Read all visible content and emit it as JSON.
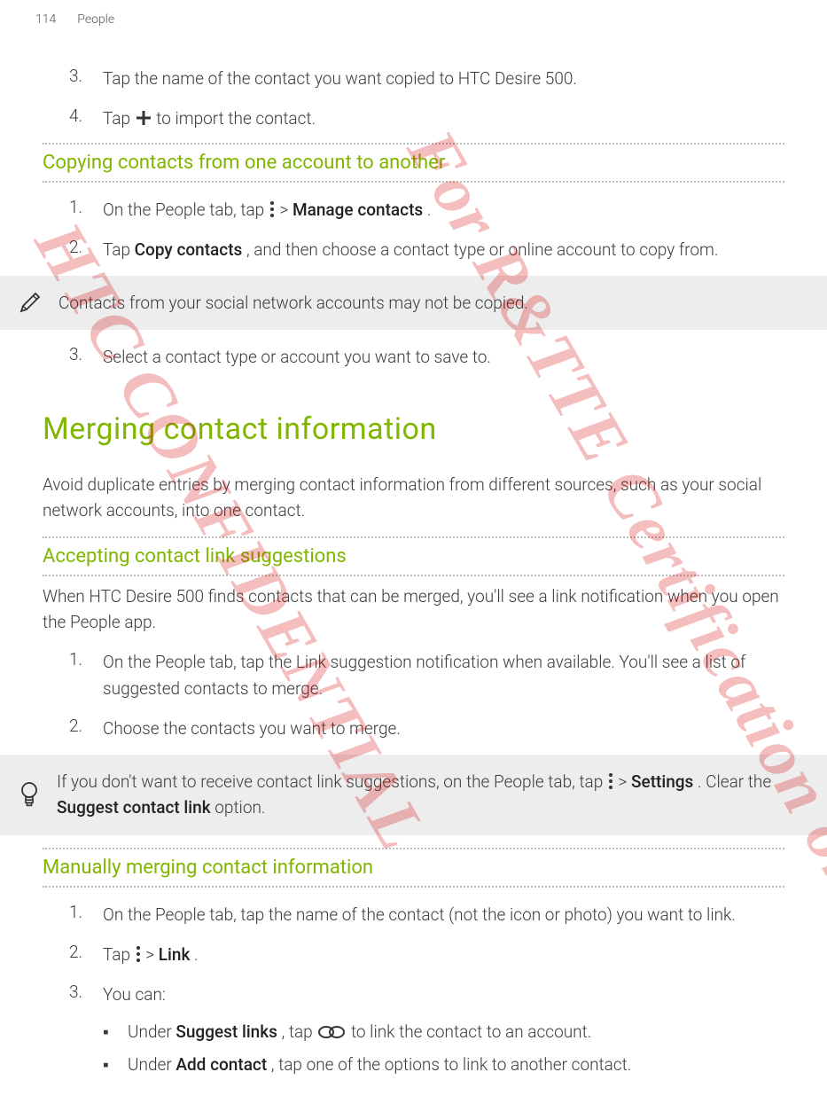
{
  "header": {
    "page_num": "114",
    "section": "People"
  },
  "watermark": {
    "line1": "HTC CONFIDENTIAL",
    "line2": "For R&TTE Certification only"
  },
  "step3top": {
    "num": "3.",
    "text": "Tap the name of the contact you want copied to HTC Desire 500."
  },
  "step4top": {
    "num": "4.",
    "pre": "Tap ",
    "post": " to import the contact."
  },
  "sec_copy": {
    "heading": "Copying contacts from one account to another",
    "s1": {
      "num": "1.",
      "a": "On the People tab, tap ",
      "b": " > ",
      "c": "Manage contacts",
      "d": "."
    },
    "s2": {
      "num": "2.",
      "a": "Tap ",
      "b": "Copy contacts",
      "c": ", and then choose a contact type or online account to copy from."
    },
    "note": "Contacts from your social network accounts may not be copied.",
    "s3": {
      "num": "3.",
      "text": "Select a contact type or account you want to save to."
    }
  },
  "sec_merge": {
    "h1": "Merging contact information",
    "intro": "Avoid duplicate entries by merging contact information from different sources, such as your social network accounts, into one contact.",
    "accept": {
      "heading": "Accepting contact link suggestions",
      "intro": "When HTC Desire 500 finds contacts that can be merged, you'll see a link notification when you open the People app.",
      "s1": {
        "num": "1.",
        "text": "On the People tab, tap the Link suggestion notification when available. You'll see a list of suggested contacts to merge."
      },
      "s2": {
        "num": "2.",
        "text": "Choose the contacts you want to merge."
      },
      "tip_a": "If you don't want to receive contact link suggestions, on the People tab, tap ",
      "tip_b": " > ",
      "tip_c": "Settings",
      "tip_d": ". Clear the ",
      "tip_e": "Suggest contact link",
      "tip_f": " option."
    },
    "manual": {
      "heading": "Manually merging contact information",
      "s1": {
        "num": "1.",
        "text": "On the People tab, tap the name of the contact (not the icon or photo) you want to link."
      },
      "s2": {
        "num": "2.",
        "a": "Tap ",
        "b": " > ",
        "c": "Link",
        "d": "."
      },
      "s3": {
        "num": "3.",
        "text": "You can:"
      },
      "b1": {
        "a": "Under ",
        "b": "Suggest links",
        "c": ", tap ",
        "d": "  to link the contact to an account."
      },
      "b2": {
        "a": "Under ",
        "b": "Add contact",
        "c": ", tap one of the options to link to another contact."
      }
    }
  }
}
